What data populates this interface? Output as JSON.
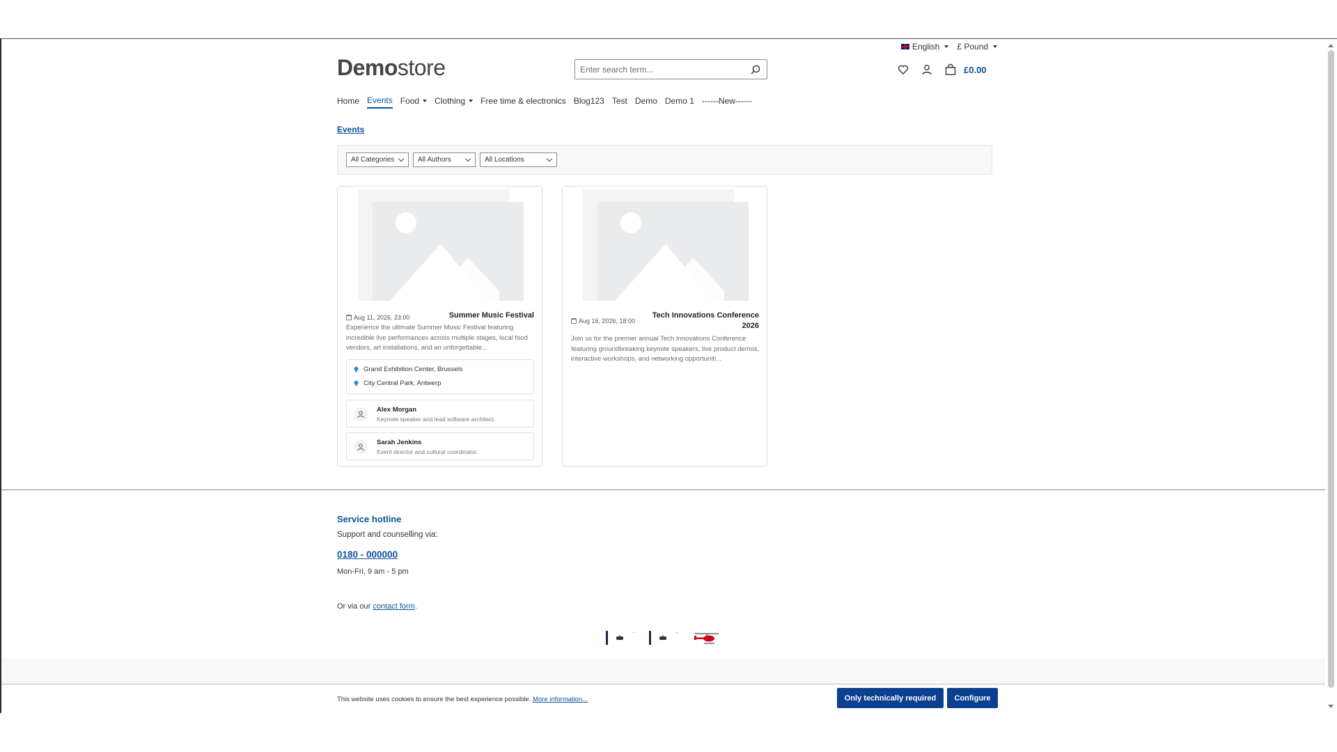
{
  "topbar": {
    "language": "English",
    "currency": "£ Pound"
  },
  "logo": {
    "bold": "Demo",
    "regular": "store"
  },
  "search": {
    "placeholder": "Enter search term..."
  },
  "cart": {
    "total": "£0.00"
  },
  "nav": {
    "items": [
      {
        "label": "Home",
        "dropdown": false
      },
      {
        "label": "Events",
        "dropdown": false,
        "active": true
      },
      {
        "label": "Food",
        "dropdown": true
      },
      {
        "label": "Clothing",
        "dropdown": true
      },
      {
        "label": "Free time & electronics",
        "dropdown": false
      },
      {
        "label": "Blog123",
        "dropdown": false
      },
      {
        "label": "Test",
        "dropdown": false
      },
      {
        "label": "Demo",
        "dropdown": false
      },
      {
        "label": "Demo 1",
        "dropdown": false
      },
      {
        "label": "------New------",
        "dropdown": false
      }
    ]
  },
  "breadcrumb": "Events",
  "filters": [
    {
      "label": "All Categories"
    },
    {
      "label": "All Authors"
    },
    {
      "label": "All Locations"
    }
  ],
  "events": [
    {
      "date": "Aug 11, 2026, 23:00",
      "title": "Summer Music Festival",
      "description": "Experience the ultimate Summer Music Festival featuring incredible live performances across multiple stages, local food vendors, art installations, and an unforgettable...",
      "locations": [
        "Grand Exhibition Center, Brussels",
        "City Central Park, Antwerp"
      ],
      "speakers": [
        {
          "name": "Alex Morgan",
          "role": "Keynote speaker and lead software architect."
        },
        {
          "name": "Sarah Jenkins",
          "role": "Event director and cultural coordinator."
        }
      ]
    },
    {
      "date": "Aug 16, 2026, 18:00",
      "title": "Tech Innovations Conference 2026",
      "description": "Join us for the premier annual Tech Innovations Conference featuring groundbreaking keynote speakers, live product demos, interactive workshops, and networking opportuniti...",
      "locations": [],
      "speakers": []
    }
  ],
  "footer": {
    "hotline_title": "Service hotline",
    "hotline_sub": "Support and counselling via:",
    "phone": "0180 - 000000",
    "hours": "Mon-Fri, 9 am - 5 pm",
    "contact_prefix": "Or via our",
    "contact_link": "contact form",
    "contact_suffix": "."
  },
  "cookie": {
    "text": "This website uses cookies to ensure the best experience possible.",
    "link": "More information...",
    "btn_required": "Only technically required",
    "btn_configure": "Configure"
  },
  "colors": {
    "accent": "#0b539b",
    "button": "#0b3f8f",
    "placeholder_bg": "#eaebed"
  }
}
